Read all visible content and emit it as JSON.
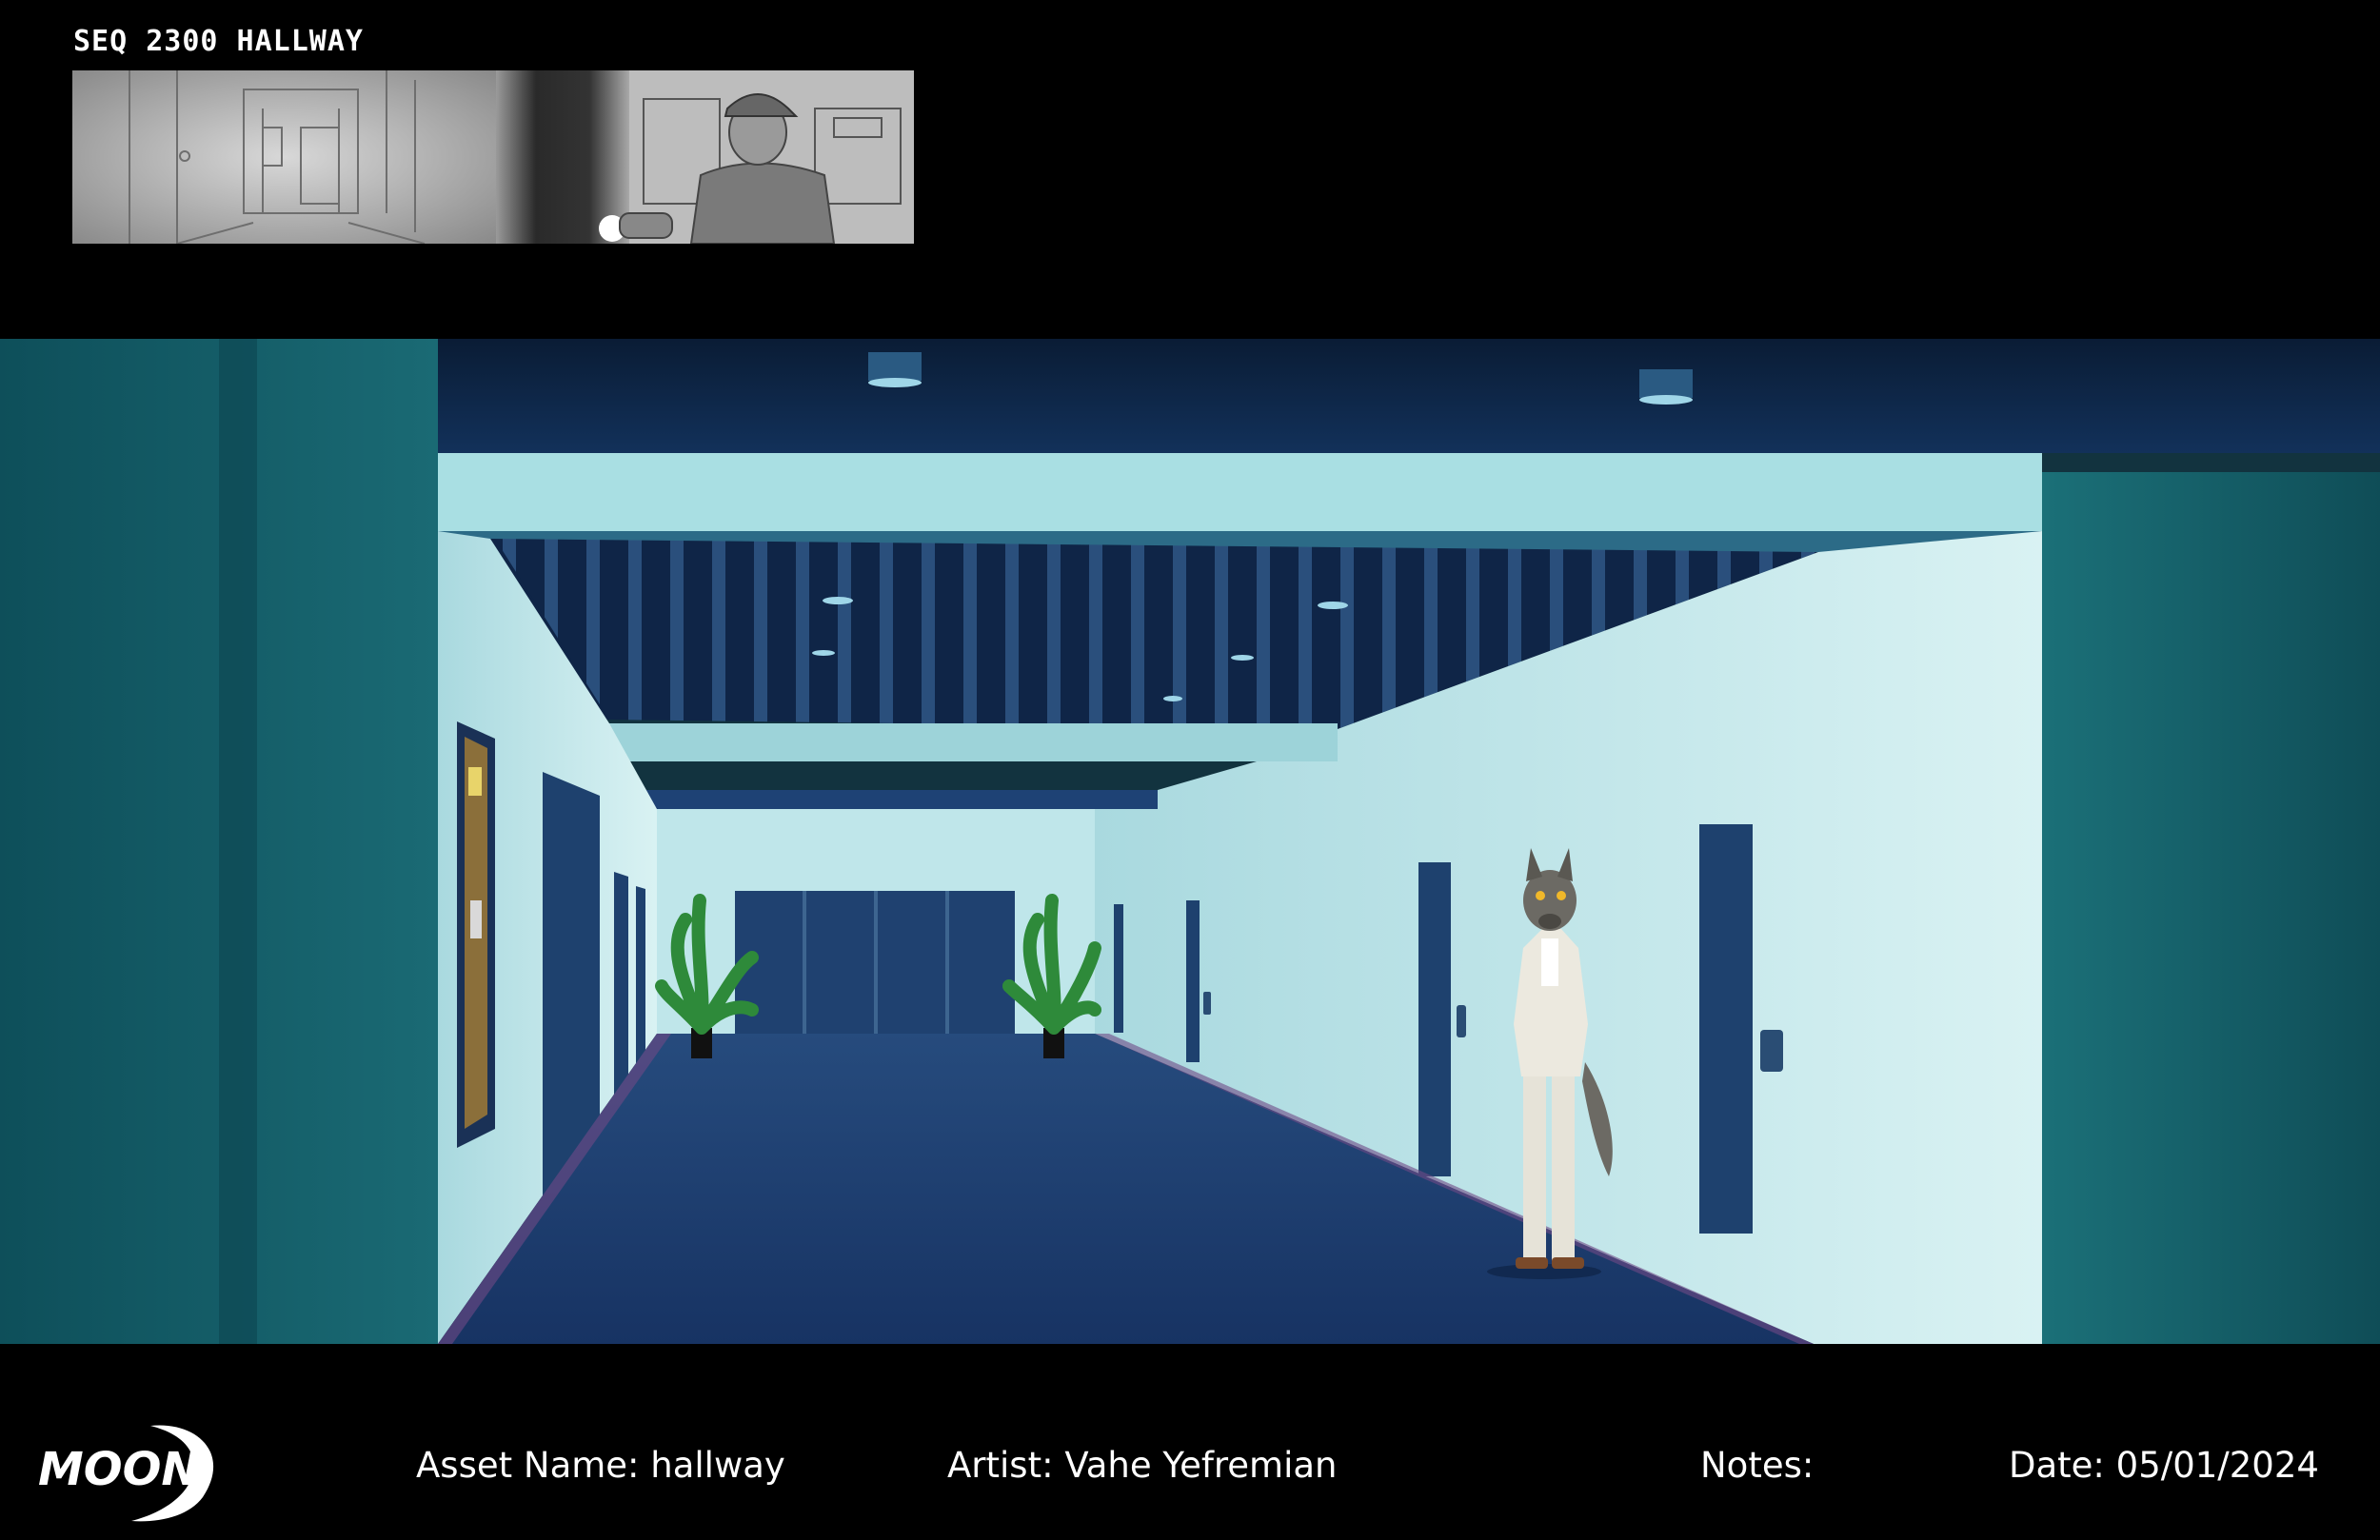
{
  "header": {
    "sequence_title": "SEQ 2300 HALLWAY"
  },
  "storyboard_thumbnail": {
    "panels": [
      "hallway-sketch",
      "guard-with-flashlight-sketch"
    ]
  },
  "scene": {
    "description_icons": [
      "hallway",
      "potted-plant",
      "wolf-character",
      "ceiling-light",
      "door"
    ],
    "colors": {
      "wall": "#bfe6ea",
      "side_wall": "#175e67",
      "ceiling": "#0d2a4b",
      "carpet": "#1c3a69",
      "frame_black": "#000000"
    }
  },
  "footer": {
    "logo_text": "MOON",
    "asset_name": "Asset Name: hallway",
    "artist": "Artist: Vahe Yefremian",
    "notes": "Notes:",
    "date": "Date: 05/01/2024"
  }
}
